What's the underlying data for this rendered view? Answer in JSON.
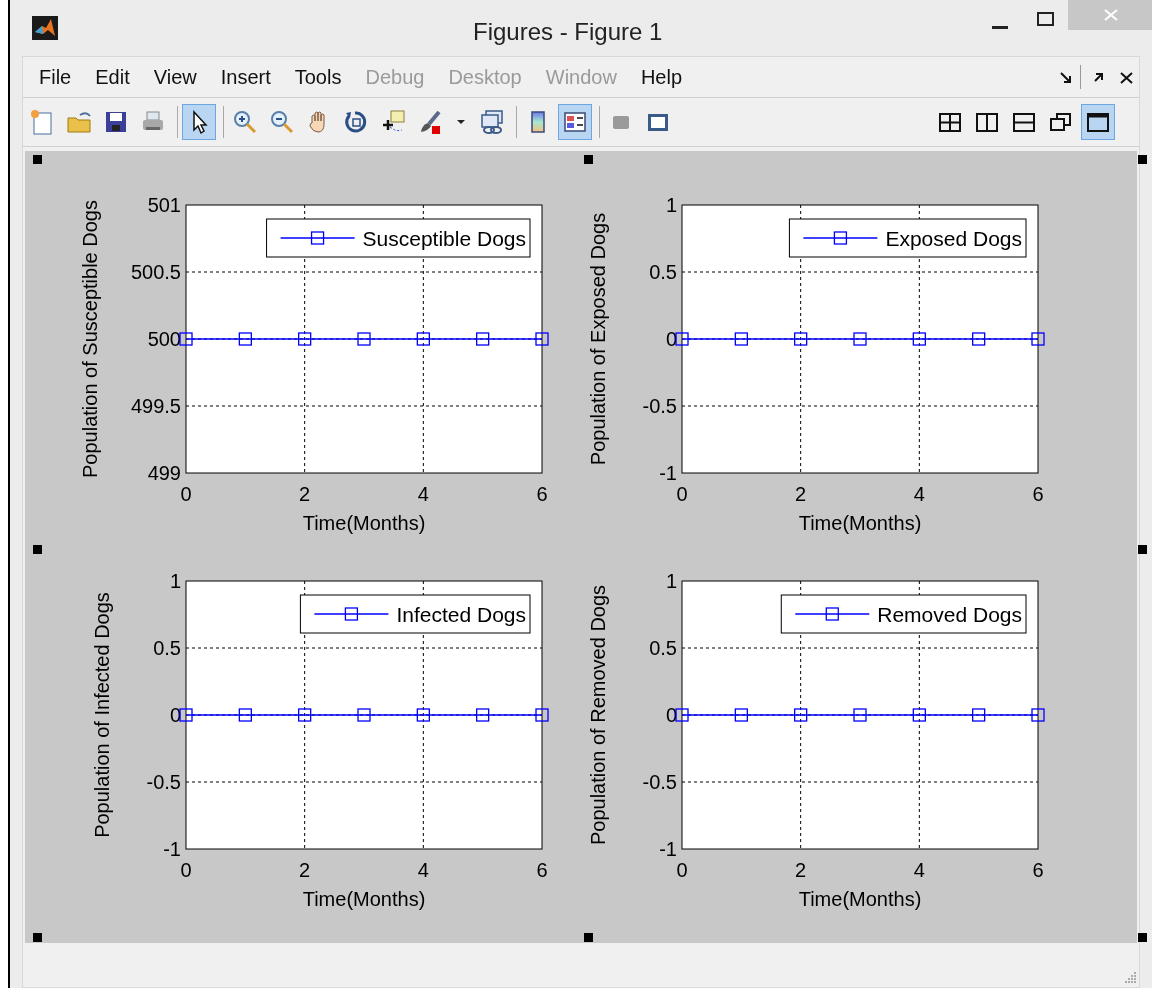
{
  "window": {
    "title": "Figures - Figure 1"
  },
  "menu": [
    {
      "label": "File",
      "disabled": false
    },
    {
      "label": "Edit",
      "disabled": false
    },
    {
      "label": "View",
      "disabled": false
    },
    {
      "label": "Insert",
      "disabled": false
    },
    {
      "label": "Tools",
      "disabled": false
    },
    {
      "label": "Debug",
      "disabled": true
    },
    {
      "label": "Desktop",
      "disabled": true
    },
    {
      "label": "Window",
      "disabled": true
    },
    {
      "label": "Help",
      "disabled": false
    }
  ],
  "toolbar": {
    "left": [
      {
        "selected": false
      },
      {
        "selected": false
      },
      {
        "selected": false
      },
      {
        "selected": false
      },
      {
        "selected": true
      },
      {
        "selected": false
      },
      {
        "selected": false
      },
      {
        "selected": false
      },
      {
        "selected": false
      },
      {
        "selected": false
      },
      {
        "selected": false
      },
      {
        "selected": false
      },
      {
        "selected": false
      },
      {
        "selected": true
      },
      {
        "selected": false
      },
      {
        "selected": false
      }
    ],
    "right": [
      {
        "selected": false
      },
      {
        "selected": false
      },
      {
        "selected": false
      },
      {
        "selected": false
      },
      {
        "selected": true
      }
    ]
  },
  "plots": [
    {
      "chart_data": {
        "type": "line",
        "xlabel": "Time(Months)",
        "ylabel": "Population of Susceptible Dogs",
        "x": [
          0,
          1,
          2,
          3,
          4,
          5,
          6
        ],
        "series": [
          {
            "name": "Susceptible Dogs",
            "color": "#0000ff",
            "marker": "square",
            "values": [
              500,
              500,
              500,
              500,
              500,
              500,
              500
            ]
          }
        ],
        "grid": true,
        "xlim": [
          0,
          6
        ],
        "ylim": [
          499,
          501
        ],
        "xticks": [
          0,
          2,
          4,
          6
        ],
        "yticks": [
          499,
          499.5,
          500,
          500.5,
          501
        ]
      }
    },
    {
      "chart_data": {
        "type": "line",
        "xlabel": "Time(Months)",
        "ylabel": "Population of Exposed Dogs",
        "x": [
          0,
          1,
          2,
          3,
          4,
          5,
          6
        ],
        "series": [
          {
            "name": "Exposed Dogs",
            "color": "#0000ff",
            "marker": "square",
            "values": [
              0,
              0,
              0,
              0,
              0,
              0,
              0
            ]
          }
        ],
        "grid": true,
        "xlim": [
          0,
          6
        ],
        "ylim": [
          -1,
          1
        ],
        "xticks": [
          0,
          2,
          4,
          6
        ],
        "yticks": [
          -1,
          -0.5,
          0,
          0.5,
          1
        ]
      }
    },
    {
      "chart_data": {
        "type": "line",
        "xlabel": "Time(Months)",
        "ylabel": "Population of Infected Dogs",
        "x": [
          0,
          1,
          2,
          3,
          4,
          5,
          6
        ],
        "series": [
          {
            "name": "Infected Dogs",
            "color": "#0000ff",
            "marker": "square",
            "values": [
              0,
              0,
              0,
              0,
              0,
              0,
              0
            ]
          }
        ],
        "grid": true,
        "xlim": [
          0,
          6
        ],
        "ylim": [
          -1,
          1
        ],
        "xticks": [
          0,
          2,
          4,
          6
        ],
        "yticks": [
          -1,
          -0.5,
          0,
          0.5,
          1
        ]
      }
    },
    {
      "chart_data": {
        "type": "line",
        "xlabel": "Time(Months)",
        "ylabel": "Population of Removed Dogs",
        "x": [
          0,
          1,
          2,
          3,
          4,
          5,
          6
        ],
        "series": [
          {
            "name": "Removed Dogs",
            "color": "#0000ff",
            "marker": "square",
            "values": [
              0,
              0,
              0,
              0,
              0,
              0,
              0
            ]
          }
        ],
        "grid": true,
        "xlim": [
          0,
          6
        ],
        "ylim": [
          -1,
          1
        ],
        "xticks": [
          0,
          2,
          4,
          6
        ],
        "yticks": [
          -1,
          -0.5,
          0,
          0.5,
          1
        ]
      }
    }
  ]
}
